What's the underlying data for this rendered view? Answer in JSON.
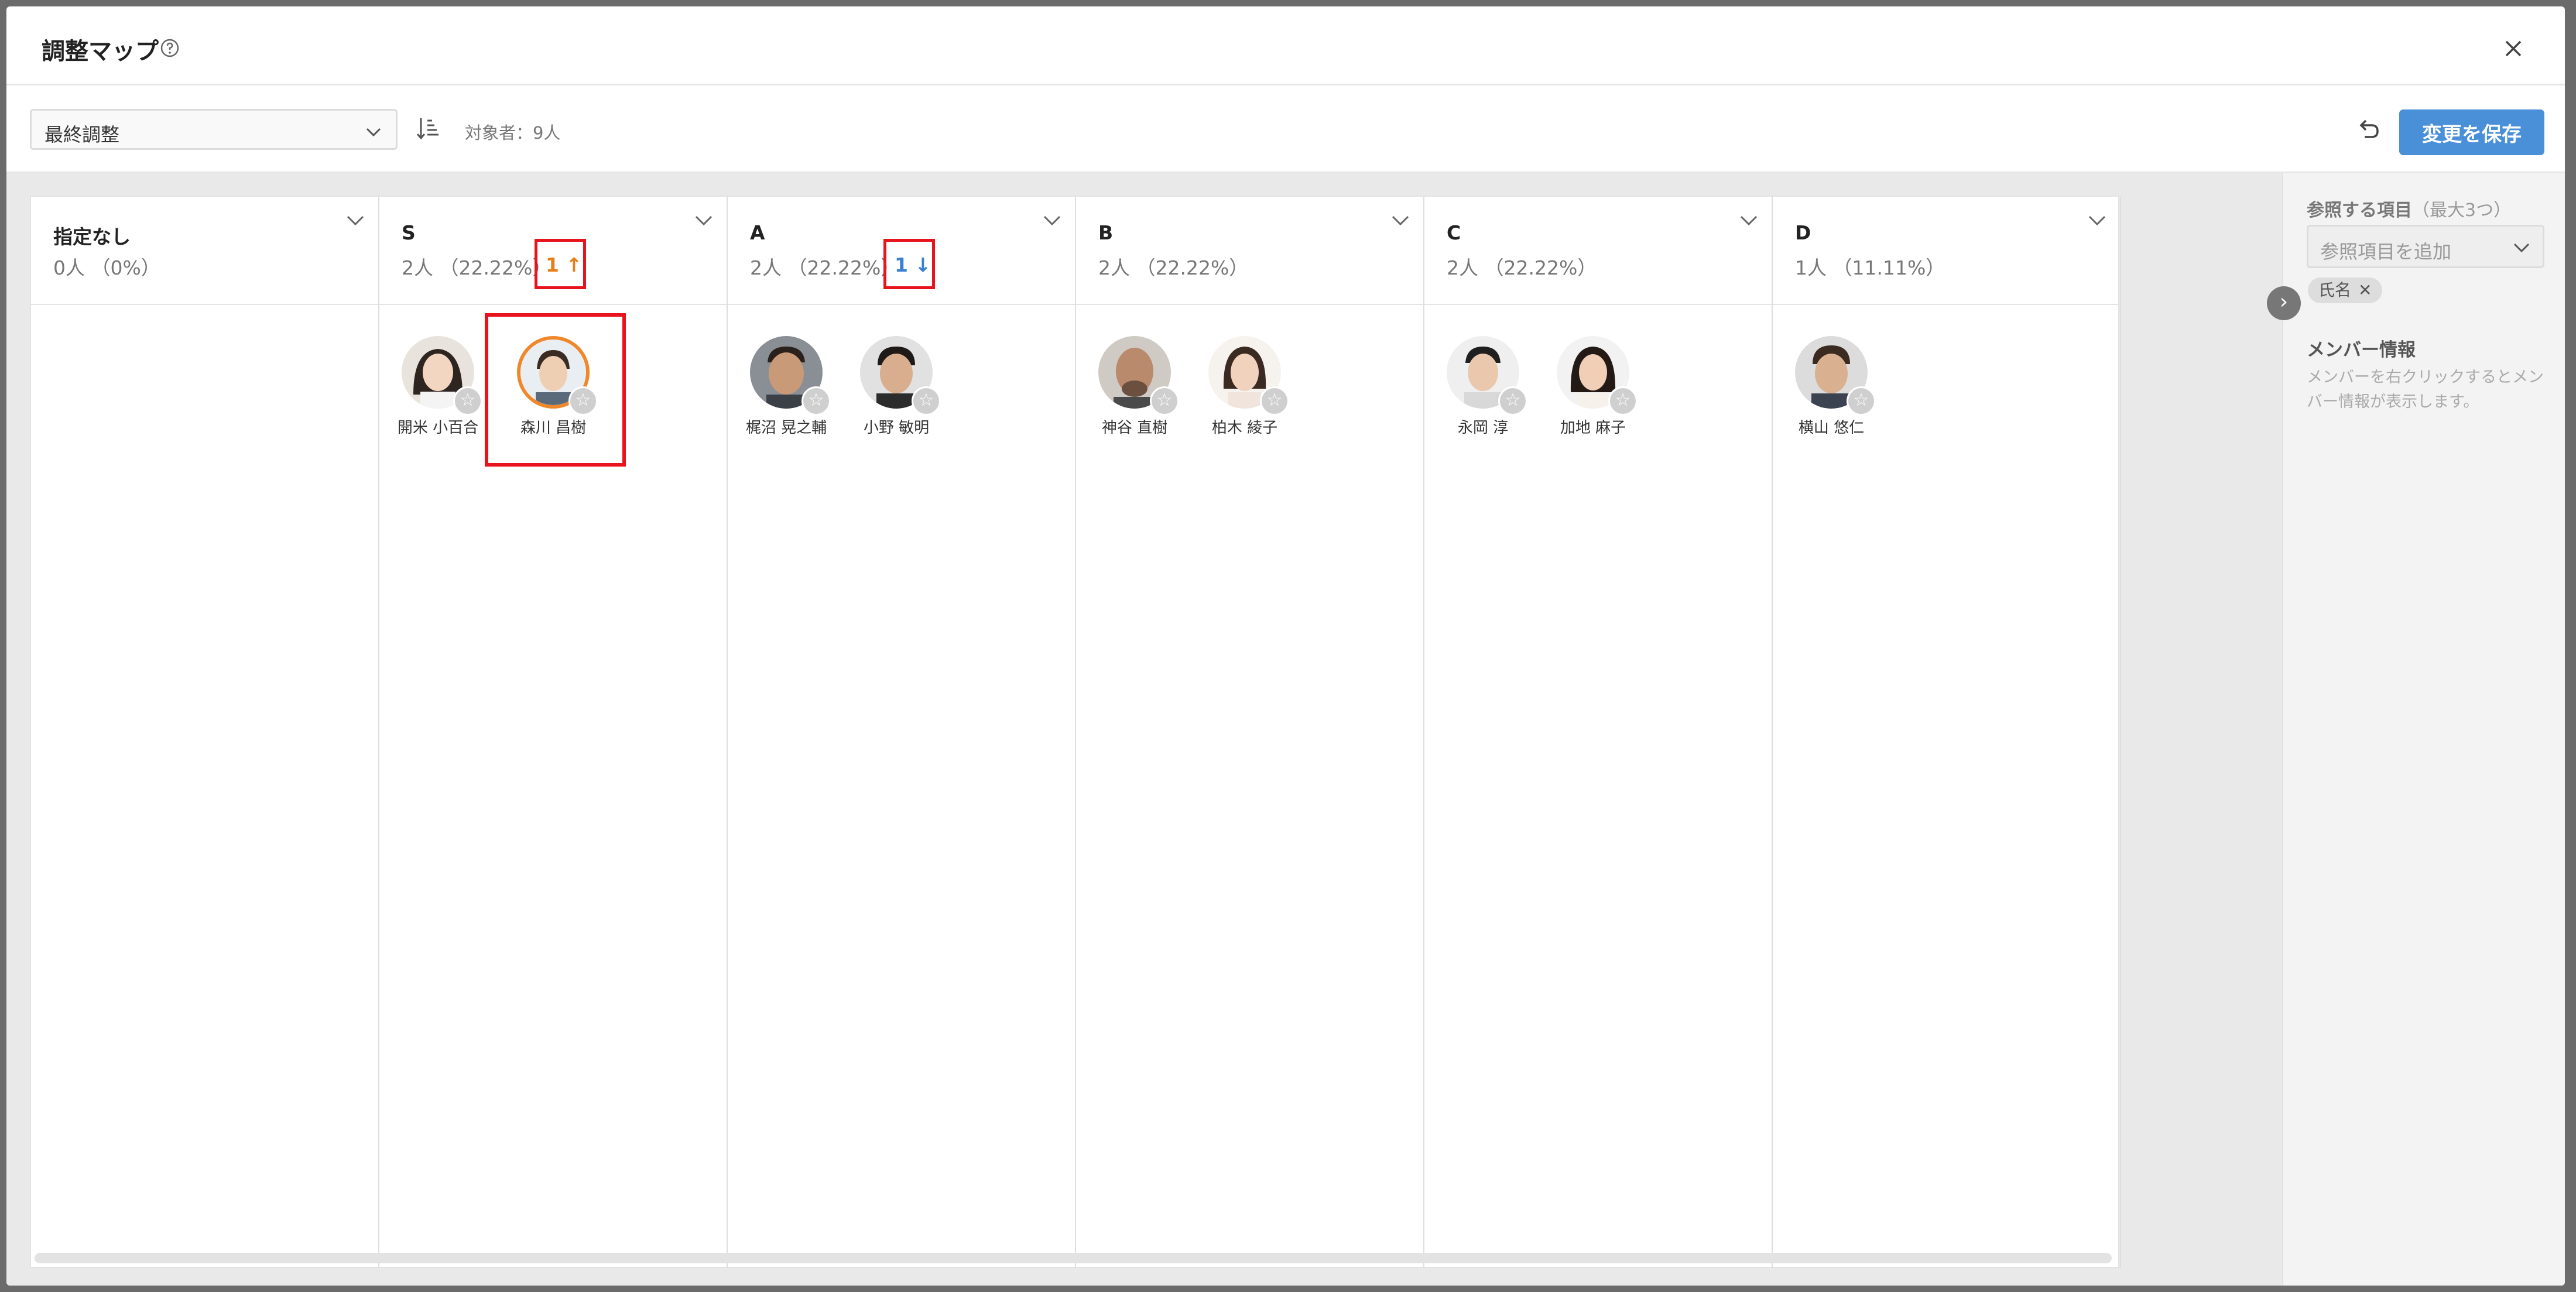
{
  "header": {
    "title": "調整マップ",
    "help_icon": "question-circle-icon",
    "close_icon": "close-icon"
  },
  "toolbar": {
    "select_value": "最終調整",
    "sort_icon": "sort-icon",
    "target_count": "対象者：9人",
    "undo_icon": "undo-icon",
    "save_label": "変更を保存"
  },
  "columns": [
    {
      "name": "指定なし",
      "count": "0人 （0%）",
      "members": []
    },
    {
      "name": "S",
      "count": "2人 （22.22%）",
      "delta": "1 ↑",
      "members": [
        {
          "name": "開米 小百合"
        },
        {
          "name": "森川 昌樹",
          "selected": true
        }
      ]
    },
    {
      "name": "A",
      "count": "2人 （22.22%）",
      "delta": "1 ↓",
      "members": [
        {
          "name": "梶沼 晃之輔"
        },
        {
          "name": "小野 敏明"
        }
      ]
    },
    {
      "name": "B",
      "count": "2人 （22.22%）",
      "members": [
        {
          "name": "神谷 直樹"
        },
        {
          "name": "柏木 綾子"
        }
      ]
    },
    {
      "name": "C",
      "count": "2人 （22.22%）",
      "members": [
        {
          "name": "永岡 淳"
        },
        {
          "name": "加地 麻子"
        }
      ]
    },
    {
      "name": "D",
      "count": "1人 （11.11%）",
      "members": [
        {
          "name": "横山 悠仁"
        }
      ]
    }
  ],
  "side": {
    "ref_label": "参照する項目",
    "ref_label_sub": "（最大3つ）",
    "ref_placeholder": "参照項目を追加",
    "tag_label": "氏名",
    "tag_remove": "✕",
    "info_title": "メンバー情報",
    "info_desc": "メンバーを右クリックするとメンバー情報が表示します。"
  },
  "colors": {
    "primary": "#4a90d9",
    "highlight_red": "#e8141d",
    "up_orange": "#e87e1a",
    "down_blue": "#3a7fd5"
  }
}
